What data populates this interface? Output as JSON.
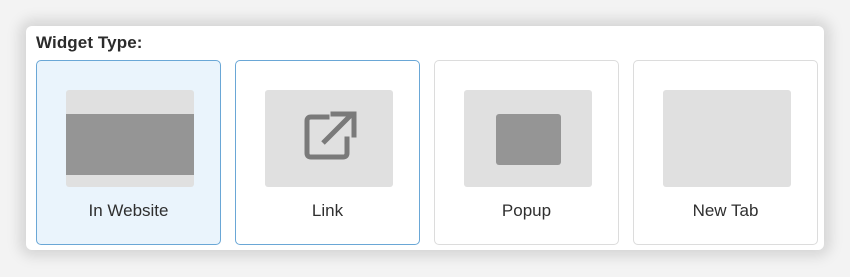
{
  "widget_type": {
    "label": "Widget Type:",
    "options": [
      {
        "label": "In Website",
        "state": "selected"
      },
      {
        "label": "Link",
        "state": "hovered"
      },
      {
        "label": "Popup",
        "state": "default"
      },
      {
        "label": "New Tab",
        "state": "default"
      }
    ]
  },
  "colors": {
    "selected_border": "#6aa7d6",
    "selected_background": "#eaf4fc",
    "thumb_background": "#e0e0e0",
    "thumb_shape": "#959595"
  },
  "icons": {
    "link": "external-link-icon"
  }
}
